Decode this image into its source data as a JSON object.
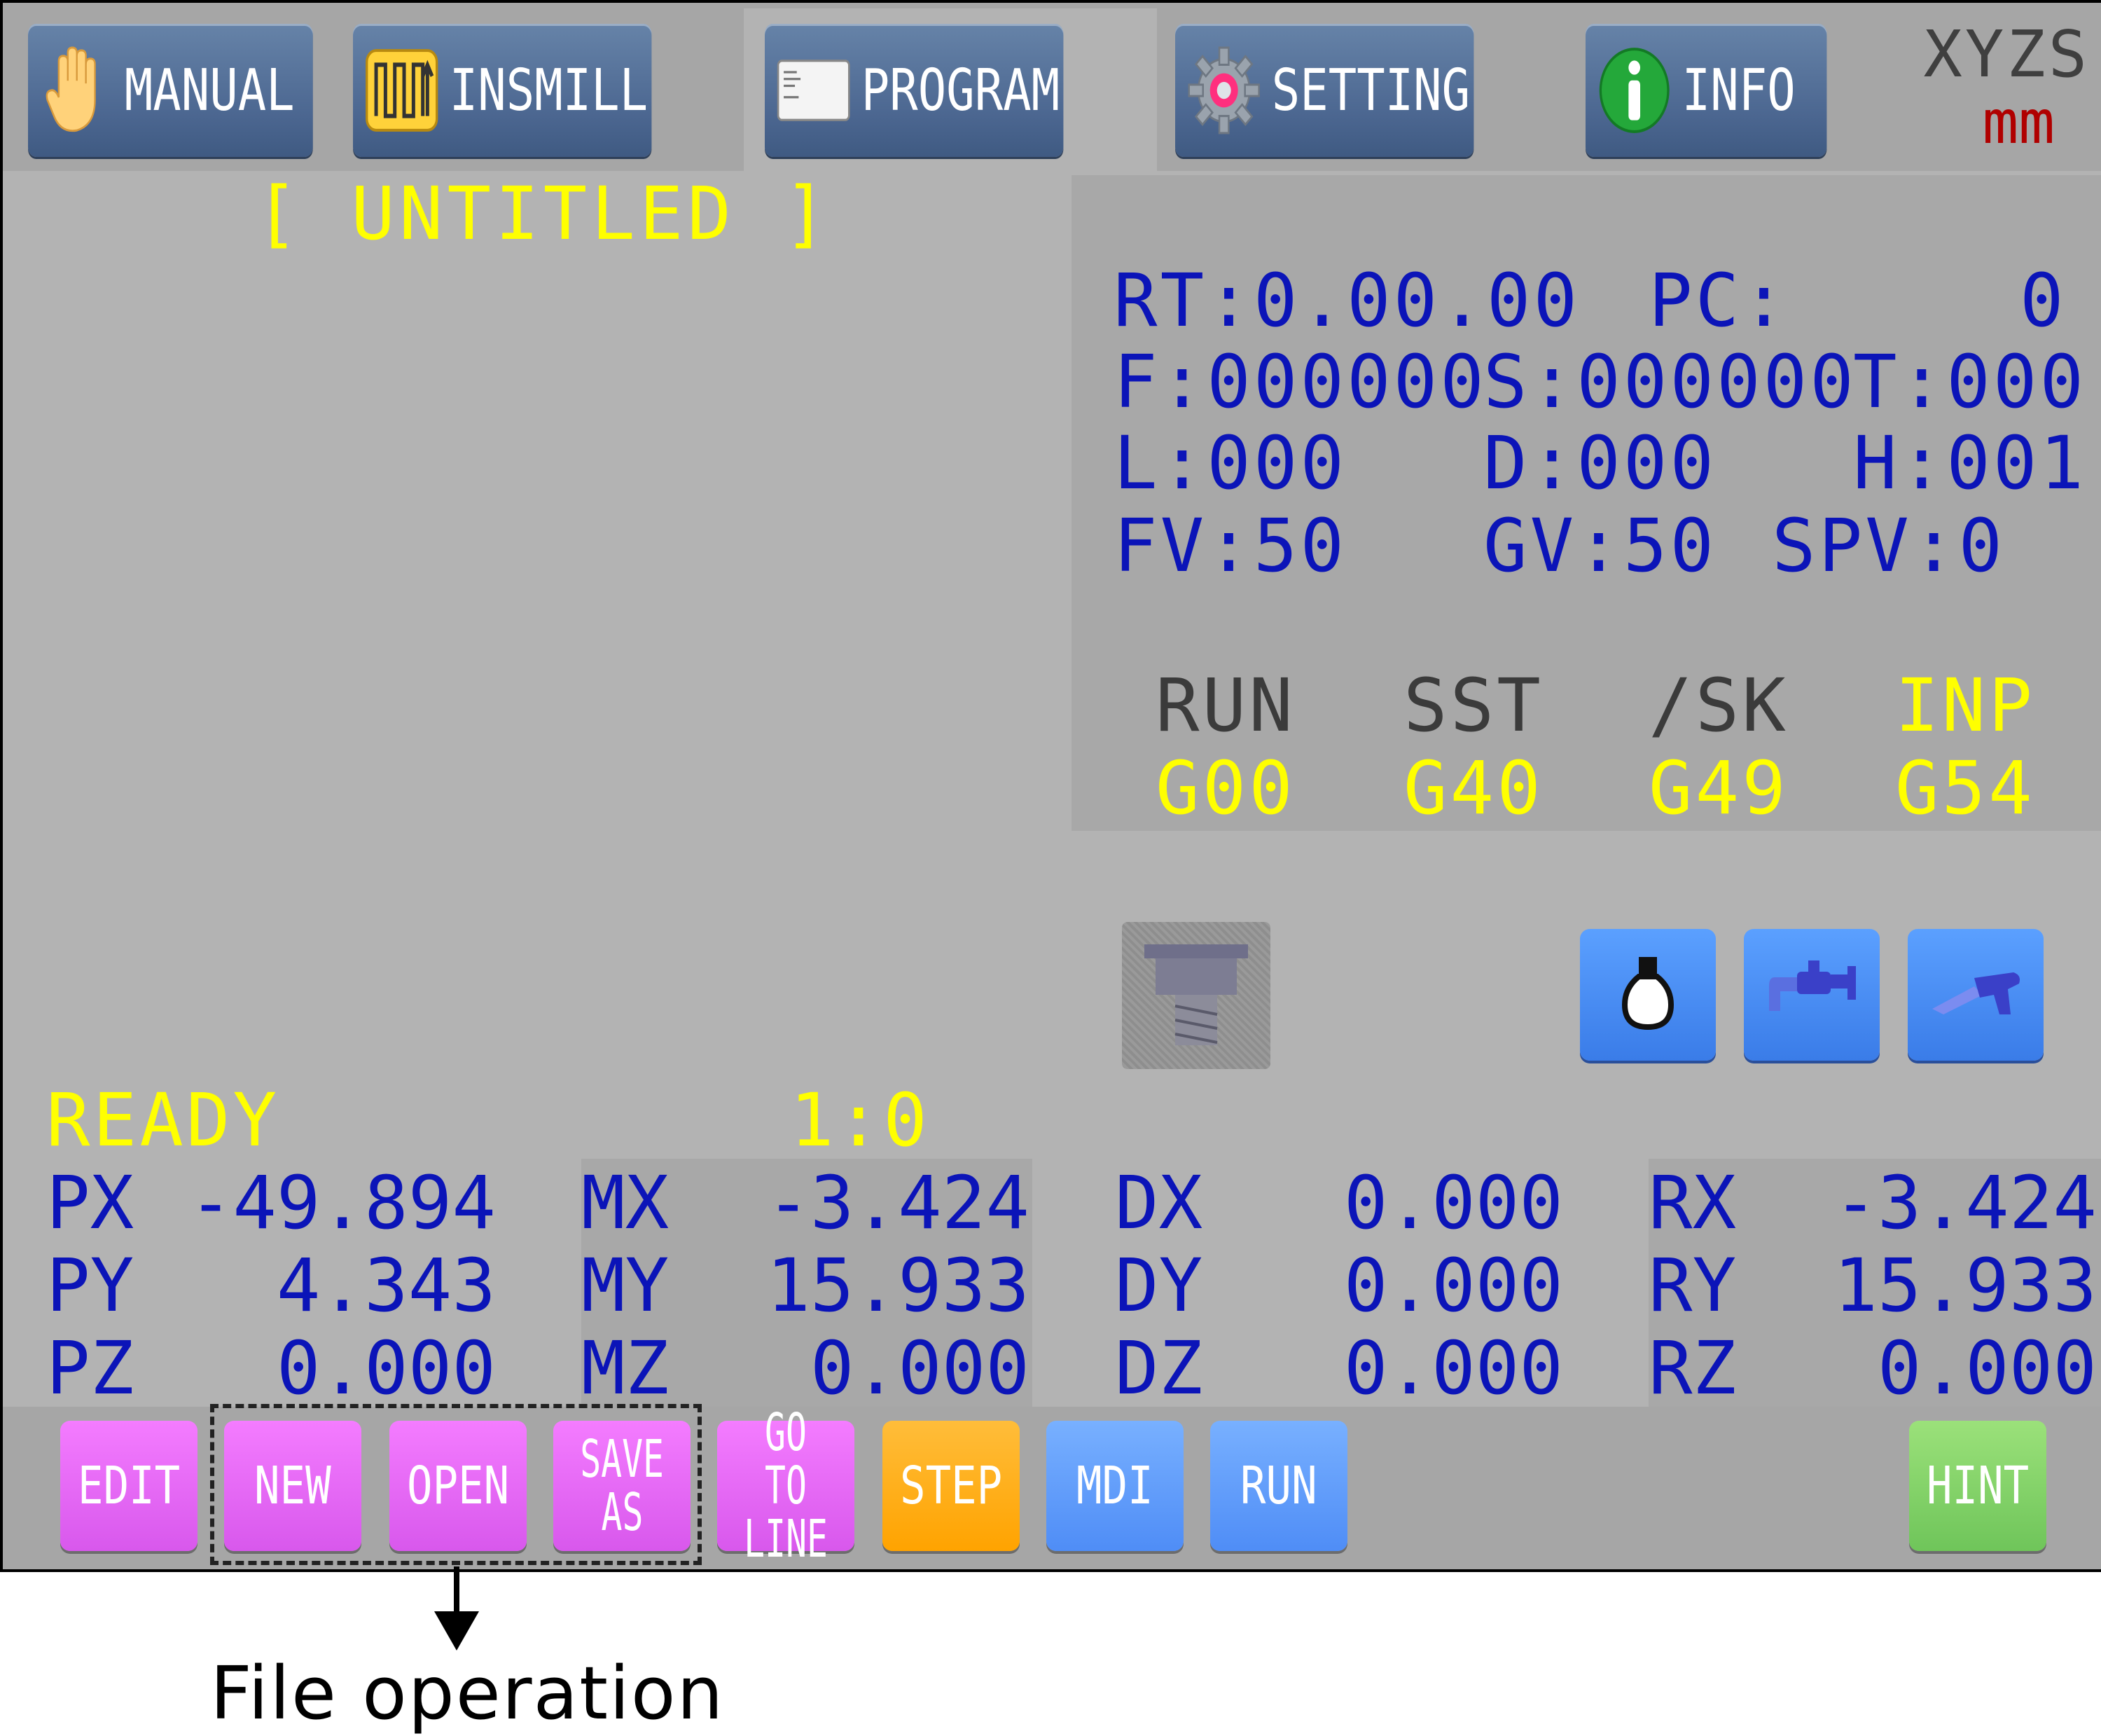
{
  "tabs": [
    {
      "label": "MANUAL",
      "icon": "hand-icon"
    },
    {
      "label": "INSMILL",
      "icon": "wave-pattern-icon"
    },
    {
      "label": "PROGRAM",
      "icon": "document-icon"
    },
    {
      "label": "SETTING",
      "icon": "gear-icon"
    },
    {
      "label": "INFO",
      "icon": "info-icon"
    }
  ],
  "units": {
    "axes": "XYZS",
    "unit": "mm"
  },
  "program_title": "[ UNTITLED ]",
  "status": {
    "rt": "RT:0.00.00",
    "pc_label": "PC:",
    "pc_value": "0",
    "f": "F:000000",
    "s": "S:000000",
    "t": "T:000",
    "l": "L:000",
    "d": "D:000",
    "h": "H:001",
    "fv": "FV:50",
    "gv": "GV:50",
    "spv": "SPV:0"
  },
  "modes": [
    {
      "mode": "RUN",
      "code": "G00",
      "mode_active": false
    },
    {
      "mode": "SST",
      "code": "G40",
      "mode_active": false
    },
    {
      "mode": "/SK",
      "code": "G49",
      "mode_active": false
    },
    {
      "mode": "INP",
      "code": "G54",
      "mode_active": true
    }
  ],
  "io_buttons": [
    "lamp-icon",
    "coolant-faucet-icon",
    "air-blow-gun-icon"
  ],
  "state": {
    "text": "READY",
    "line_info": "1:0"
  },
  "positions": {
    "P": [
      {
        "axis": "PX",
        "value": "-49.894"
      },
      {
        "axis": "PY",
        "value": "4.343"
      },
      {
        "axis": "PZ",
        "value": "0.000"
      }
    ],
    "M": [
      {
        "axis": "MX",
        "value": "-3.424"
      },
      {
        "axis": "MY",
        "value": "15.933"
      },
      {
        "axis": "MZ",
        "value": "0.000"
      }
    ],
    "D": [
      {
        "axis": "DX",
        "value": "0.000"
      },
      {
        "axis": "DY",
        "value": "0.000"
      },
      {
        "axis": "DZ",
        "value": "0.000"
      }
    ],
    "R": [
      {
        "axis": "RX",
        "value": "-3.424"
      },
      {
        "axis": "RY",
        "value": "15.933"
      },
      {
        "axis": "RZ",
        "value": "0.000"
      }
    ]
  },
  "function_buttons": [
    {
      "label": "EDIT",
      "color": "#e86cf6"
    },
    {
      "label": "NEW",
      "color": "#e86cf6"
    },
    {
      "label": "OPEN",
      "color": "#e86cf6"
    },
    {
      "label_line1": "SAVE",
      "label_line2": "AS",
      "color": "#e86cf6"
    },
    {
      "label_line1": "GO TO",
      "label_line2": "LINE",
      "color": "#e86cf6"
    },
    {
      "label": "STEP",
      "color": "#ffad1a"
    },
    {
      "label": "MDI",
      "color": "#629cfa"
    },
    {
      "label": "RUN",
      "color": "#629cfa"
    },
    {
      "label": "HINT",
      "color": "#84d468"
    }
  ],
  "annotation": {
    "caption": "File operation"
  }
}
